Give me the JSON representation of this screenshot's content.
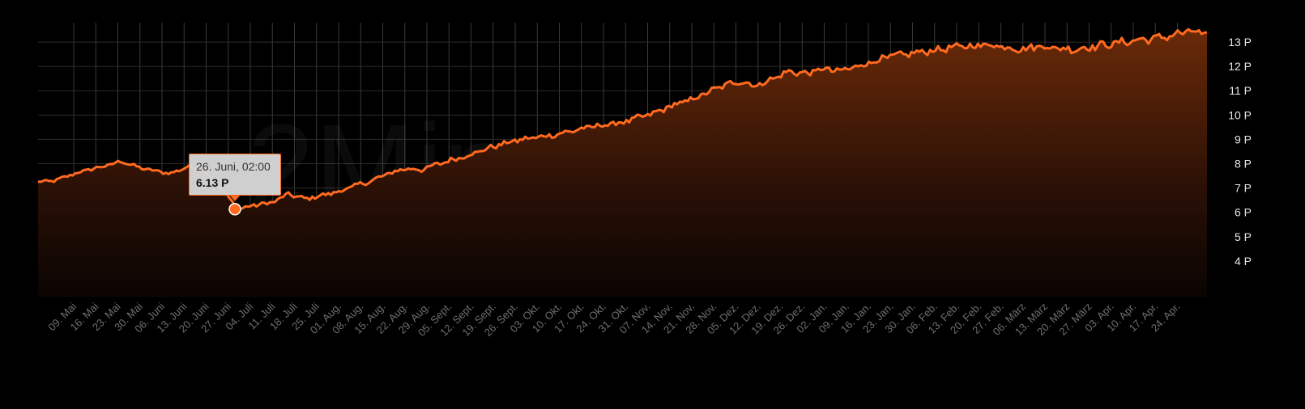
{
  "watermark": "2Miners.com",
  "colors": {
    "line": "#ff6a1f",
    "fill_top": "#5a2408",
    "background": "#000000"
  },
  "tooltip": {
    "date": "26. Juni, 02:00",
    "value_label": "6.13 P",
    "x": "26. Juni",
    "y": 6.13
  },
  "chart_data": {
    "type": "area",
    "title": "",
    "xlabel": "",
    "ylabel": "",
    "ylim": [
      2.5,
      13.8
    ],
    "grid": true,
    "y_ticks": [
      4,
      5,
      6,
      7,
      8,
      9,
      10,
      11,
      12,
      13
    ],
    "y_tick_labels": [
      "4 P",
      "5 P",
      "6 P",
      "7 P",
      "8 P",
      "9 P",
      "10 P",
      "11 P",
      "12 P",
      "13 P"
    ],
    "x_ticks": [
      "09. Mai",
      "16. Mai",
      "23. Mai",
      "30. Mai",
      "06. Juni",
      "13. Juni",
      "20. Juni",
      "27. Juni",
      "04. Juli",
      "11. Juli",
      "18. Juli",
      "25. Juli",
      "01. Aug.",
      "08. Aug.",
      "15. Aug.",
      "22. Aug.",
      "29. Aug.",
      "05. Sept.",
      "12. Sept.",
      "19. Sept.",
      "26. Sept.",
      "03. Okt.",
      "10. Okt.",
      "17. Okt.",
      "24. Okt.",
      "31. Okt.",
      "07. Nov.",
      "14. Nov.",
      "21. Nov.",
      "28. Nov.",
      "05. Dez.",
      "12. Dez.",
      "19. Dez.",
      "26. Dez.",
      "02. Jan.",
      "09. Jan.",
      "16. Jan.",
      "23. Jan.",
      "30. Jan.",
      "06. Feb.",
      "13. Feb.",
      "20. Feb.",
      "27. Feb.",
      "06. März",
      "13. März",
      "20. März",
      "27. März",
      "03. Apr.",
      "10. Apr.",
      "17. Apr.",
      "24. Apr."
    ],
    "series": [
      {
        "values": [
          7.25,
          7.3,
          7.55,
          7.75,
          7.9,
          8.1,
          7.85,
          7.7,
          7.6,
          7.9,
          7.7,
          6.9,
          6.13,
          6.3,
          6.4,
          6.75,
          6.55,
          6.7,
          6.85,
          7.1,
          7.3,
          7.6,
          7.8,
          7.75,
          8.0,
          8.2,
          8.4,
          8.65,
          8.85,
          9.0,
          9.1,
          9.2,
          9.35,
          9.5,
          9.6,
          9.7,
          9.9,
          10.1,
          10.4,
          10.6,
          10.9,
          11.2,
          11.4,
          11.2,
          11.5,
          11.8,
          11.7,
          11.9,
          11.8,
          12.0,
          12.2,
          12.4,
          12.5,
          12.6,
          12.7,
          12.8,
          12.85,
          12.9,
          12.8,
          12.7,
          12.85,
          12.75,
          12.7,
          12.8,
          12.9,
          13.0,
          13.1,
          13.15,
          13.3,
          13.45,
          13.3
        ]
      }
    ]
  }
}
